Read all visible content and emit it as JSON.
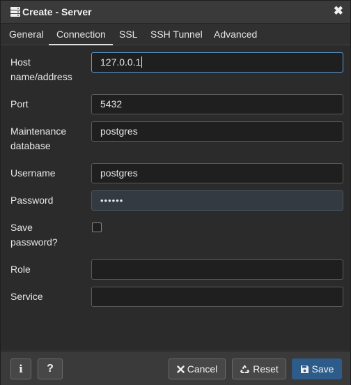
{
  "window": {
    "title": "Create - Server",
    "close_glyph": "✖"
  },
  "tabs": [
    {
      "label": "General",
      "active": false
    },
    {
      "label": "Connection",
      "active": true
    },
    {
      "label": "SSL",
      "active": false
    },
    {
      "label": "SSH Tunnel",
      "active": false
    },
    {
      "label": "Advanced",
      "active": false
    }
  ],
  "form": {
    "host": {
      "label": "Host name/address",
      "value": "127.0.0.1"
    },
    "port": {
      "label": "Port",
      "value": "5432"
    },
    "maintenance_db": {
      "label": "Maintenance database",
      "value": "postgres"
    },
    "username": {
      "label": "Username",
      "value": "postgres"
    },
    "password": {
      "label": "Password",
      "value": "••••••"
    },
    "save_password": {
      "label": "Save password?",
      "checked": false
    },
    "role": {
      "label": "Role",
      "value": ""
    },
    "service": {
      "label": "Service",
      "value": ""
    }
  },
  "footer": {
    "info_glyph": "i",
    "help_glyph": "?",
    "cancel_label": "Cancel",
    "reset_label": "Reset",
    "save_label": "Save"
  },
  "icons": {
    "title": "server-icon",
    "close": "close-icon",
    "info": "info-icon",
    "help": "help-icon",
    "cancel": "times-icon",
    "reset": "recycle-icon",
    "save": "floppy-disk-icon"
  },
  "colors": {
    "dialog_bg": "#303030",
    "content_bg": "#2b2b2b",
    "input_bg": "#1f1f1f",
    "focus_border": "#5b9bd5",
    "primary_button": "#2d5c8a"
  }
}
